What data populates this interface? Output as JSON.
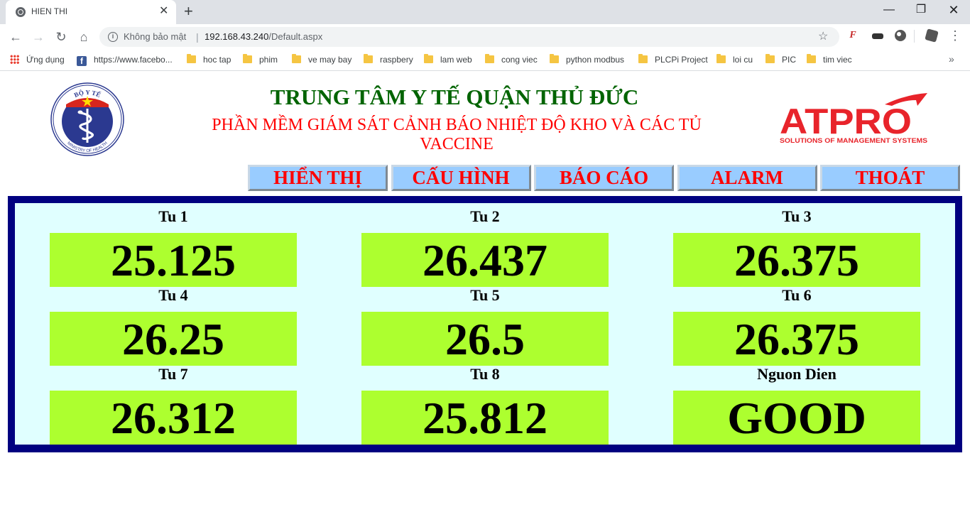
{
  "browser": {
    "tab_title": "HIEN THI",
    "security_label": "Không bảo mật",
    "url_host": "192.168.43.240",
    "url_path": "/Default.aspx",
    "bookmarks": [
      {
        "label": "Ứng dụng",
        "icon": "apps-icon"
      },
      {
        "label": "https://www.facebo...",
        "icon": "facebook-icon"
      },
      {
        "label": "hoc tap",
        "icon": "folder-icon"
      },
      {
        "label": "phim",
        "icon": "folder-icon"
      },
      {
        "label": "ve may bay",
        "icon": "folder-icon"
      },
      {
        "label": "raspbery",
        "icon": "folder-icon"
      },
      {
        "label": "lam web",
        "icon": "folder-icon"
      },
      {
        "label": "cong viec",
        "icon": "folder-icon"
      },
      {
        "label": "python modbus",
        "icon": "folder-icon"
      },
      {
        "label": "PLCPi Project",
        "icon": "folder-icon"
      },
      {
        "label": "loi cu",
        "icon": "folder-icon"
      },
      {
        "label": "PIC",
        "icon": "folder-icon"
      },
      {
        "label": "tim viec",
        "icon": "folder-icon"
      }
    ]
  },
  "header": {
    "title": "TRUNG TÂM Y TẾ QUẬN THỦ ĐỨC",
    "subtitle": "PHẦN MỀM GIÁM SÁT CẢNH BÁO NHIỆT ĐỘ KHO VÀ CÁC TỦ VACCINE",
    "left_logo": {
      "top_text": "BỘ Y TẾ",
      "bottom_text": "MINISTRY OF HEALTH"
    },
    "right_logo": {
      "brand": "ATPRO",
      "tagline": "SOLUTIONS OF MANAGEMENT SYSTEMS"
    }
  },
  "menu": [
    {
      "label": "HIỂN THỊ"
    },
    {
      "label": "CẤU HÌNH"
    },
    {
      "label": "BÁO CÁO"
    },
    {
      "label": "ALARM"
    },
    {
      "label": "THOÁT"
    }
  ],
  "readings": [
    {
      "label": "Tu 1",
      "value": "25.125"
    },
    {
      "label": "Tu 2",
      "value": "26.437"
    },
    {
      "label": "Tu 3",
      "value": "26.375"
    },
    {
      "label": "Tu 4",
      "value": "26.25"
    },
    {
      "label": "Tu 5",
      "value": "26.5"
    },
    {
      "label": "Tu 6",
      "value": "26.375"
    },
    {
      "label": "Tu 7",
      "value": "26.312"
    },
    {
      "label": "Tu 8",
      "value": "25.812"
    },
    {
      "label": "Nguon Dien",
      "value": "GOOD"
    }
  ],
  "colors": {
    "title_green": "#006400",
    "subtitle_red": "#ff0000",
    "menu_bg": "#99ccff",
    "panel_border": "#000080",
    "panel_bg": "#e0ffff",
    "value_bg": "#adff2f"
  }
}
